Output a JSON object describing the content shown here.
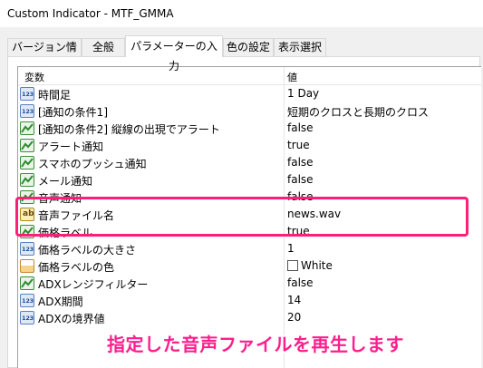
{
  "window": {
    "title": "Custom Indicator - MTF_GMMA"
  },
  "tabs": [
    {
      "label": "バージョン情報",
      "active": false
    },
    {
      "label": "全般",
      "active": false
    },
    {
      "label": "パラメーターの入力",
      "active": true
    },
    {
      "label": "色の設定",
      "active": false
    },
    {
      "label": "表示選択",
      "active": false
    }
  ],
  "grid": {
    "headers": {
      "variable": "変数",
      "value": "値"
    },
    "rows": [
      {
        "icon": "number-icon",
        "name": "時間足",
        "value": "1 Day"
      },
      {
        "icon": "number-icon",
        "name": "[通知の条件1]",
        "value": "短期のクロスと長期のクロス"
      },
      {
        "icon": "boolean-icon",
        "name": "[通知の条件2] 縦線の出現でアラート",
        "value": "false"
      },
      {
        "icon": "boolean-icon",
        "name": "アラート通知",
        "value": "true"
      },
      {
        "icon": "boolean-icon",
        "name": "スマホのプッシュ通知",
        "value": "false"
      },
      {
        "icon": "boolean-icon",
        "name": "メール通知",
        "value": "false"
      },
      {
        "icon": "boolean-icon",
        "name": "音声通知",
        "value": "false"
      },
      {
        "icon": "string-icon",
        "name": "音声ファイル名",
        "value": "news.wav"
      },
      {
        "icon": "boolean-icon",
        "name": "価格ラベル",
        "value": "true"
      },
      {
        "icon": "number-icon",
        "name": "価格ラベルの大きさ",
        "value": "1"
      },
      {
        "icon": "color-icon",
        "name": "価格ラベルの色",
        "value": "White"
      },
      {
        "icon": "boolean-icon",
        "name": "ADXレンジフィルター",
        "value": "false"
      },
      {
        "icon": "number-icon",
        "name": "ADX期間",
        "value": "14"
      },
      {
        "icon": "number-icon",
        "name": "ADXの境界値",
        "value": "20"
      }
    ]
  },
  "icons": {
    "number_text": "123",
    "string_text": "ab"
  },
  "annotation": {
    "caption": "指定した音声ファイルを再生します",
    "highlight_color": "#ff1e78",
    "caption_color": "#ff1e8c"
  }
}
